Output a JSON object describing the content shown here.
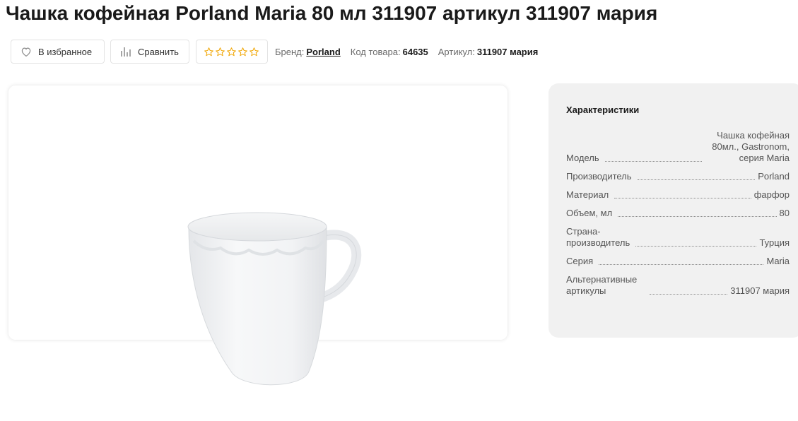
{
  "product": {
    "title": "Чашка кофейная Porland Maria 80 мл 311907 артикул 311907 мария"
  },
  "actions": {
    "favorite_label": "В избранное",
    "compare_label": "Сравнить",
    "rating_stars": 5,
    "rating_value": 0,
    "favorite_icon": "heart-icon",
    "compare_icon": "bar-chart-icon",
    "star_icon": "star-outline-icon",
    "star_color": "#f0a500"
  },
  "meta": {
    "brand_label": "Бренд:",
    "brand_value": "Porland",
    "code_label": "Код товара:",
    "code_value": "64635",
    "article_label": "Артикул:",
    "article_value": "311907 мария"
  },
  "specs": {
    "title": "Характеристики",
    "rows": [
      {
        "label": "Модель",
        "value": "Чашка кофейная 80мл., Gastronom, серия Maria"
      },
      {
        "label": "Производитель",
        "value": "Porland"
      },
      {
        "label": "Материал",
        "value": "фарфор"
      },
      {
        "label": "Объем, мл",
        "value": "80"
      },
      {
        "label": "Страна-производитель",
        "value": "Турция"
      },
      {
        "label": "Серия",
        "value": "Maria"
      },
      {
        "label": "Альтернативные артикулы",
        "value": "311907 мария"
      }
    ]
  },
  "colors": {
    "panel_bg": "#f1f1f1",
    "text": "#1a1a1a",
    "muted": "#6b6b6b"
  }
}
